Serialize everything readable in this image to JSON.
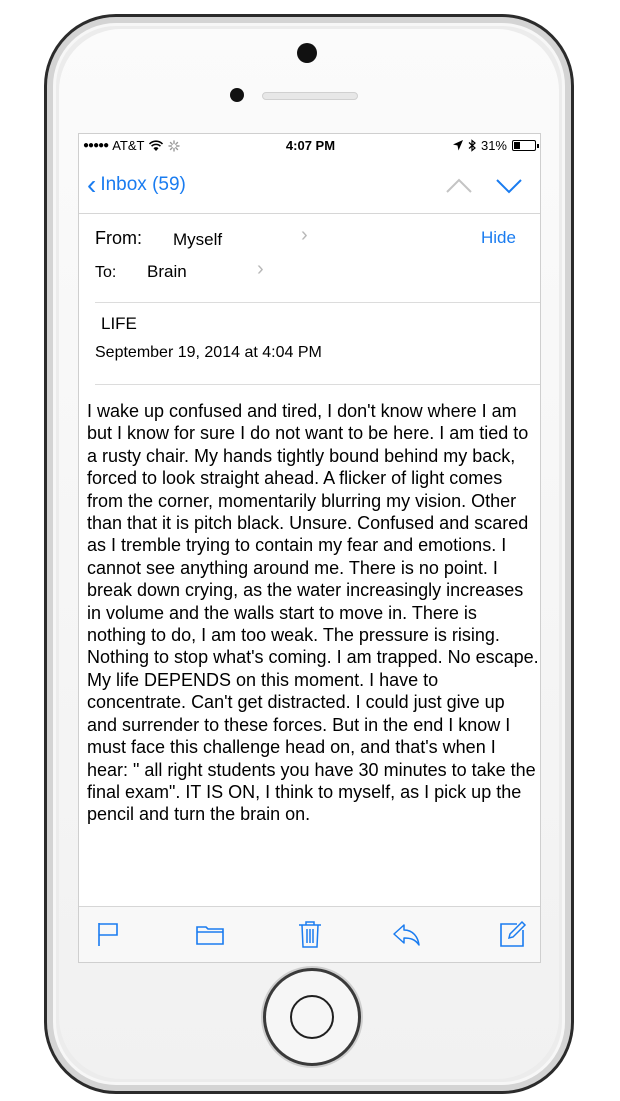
{
  "status_bar": {
    "signal": "●●●●●",
    "carrier": "AT&T",
    "time": "4:07 PM",
    "battery_text": "31%",
    "battery_level": 0.31
  },
  "nav": {
    "back_label": "Inbox (59)",
    "back_icon": "chevron-left-icon",
    "prev_icon": "chevron-up-icon",
    "next_icon": "chevron-down-icon"
  },
  "message": {
    "from_label": "From:",
    "from_value": "Myself",
    "to_label": "To:",
    "to_value": "Brain",
    "hide_label": "Hide",
    "subject": "LIFE",
    "date": "September 19, 2014 at 4:04 PM",
    "body": "I wake up confused and tired, I don't know where I am but I know for sure I do not want to be here. I am tied to a rusty chair. My hands tightly bound behind my back, forced to look straight ahead. A flicker of light comes from the corner, momentarily blurring my vision. Other than that it is pitch black. Unsure. Confused and scared as I tremble trying to contain my fear and emotions. I cannot see anything around me. There is no point. I break down crying, as the water increasingly increases in volume and the walls start to move in. There is nothing to do, I am too weak. The pressure is rising. Nothing to stop what's coming. I am trapped. No escape. My life DEPENDS on this moment. I have to concentrate. Can't get distracted. I could just give up and surrender to these forces. But in the end I know I must face this challenge head on, and that's when I hear: \" all right students you have 30 minutes to take the final exam\". IT IS ON, I think to myself, as I pick up the pencil and turn the brain on."
  },
  "toolbar": {
    "icons": [
      "flag-icon",
      "folder-icon",
      "trash-icon",
      "reply-icon",
      "compose-icon"
    ]
  },
  "colors": {
    "accent": "#1a7cf0",
    "separator": "#d6d6d6"
  }
}
